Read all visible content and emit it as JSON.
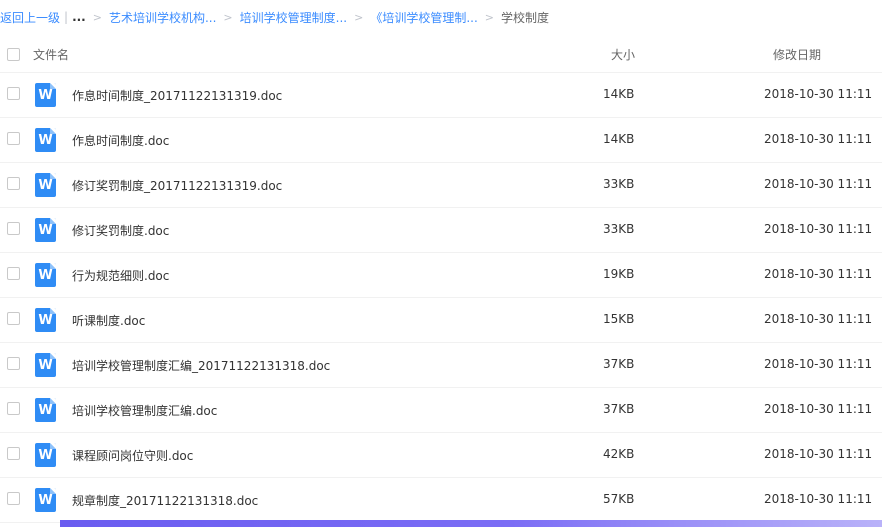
{
  "breadcrumb": {
    "back_label": "返回上一级",
    "ellipsis": "...",
    "items": [
      "艺术培训学校机构...",
      "培训学校管理制度...",
      "《培训学校管理制..."
    ],
    "current": "学校制度",
    "separator": ">"
  },
  "table": {
    "columns": {
      "name": "文件名",
      "size": "大小",
      "modified": "修改日期"
    },
    "rows": [
      {
        "name": "作息时间制度_20171122131319.doc",
        "size": "14KB",
        "modified": "2018-10-30 11:11",
        "icon": "word-doc-icon"
      },
      {
        "name": "作息时间制度.doc",
        "size": "14KB",
        "modified": "2018-10-30 11:11",
        "icon": "word-doc-icon"
      },
      {
        "name": "修订奖罚制度_20171122131319.doc",
        "size": "33KB",
        "modified": "2018-10-30 11:11",
        "icon": "word-doc-icon"
      },
      {
        "name": "修订奖罚制度.doc",
        "size": "33KB",
        "modified": "2018-10-30 11:11",
        "icon": "word-doc-icon"
      },
      {
        "name": "行为规范细则.doc",
        "size": "19KB",
        "modified": "2018-10-30 11:11",
        "icon": "word-doc-icon"
      },
      {
        "name": "听课制度.doc",
        "size": "15KB",
        "modified": "2018-10-30 11:11",
        "icon": "word-doc-icon"
      },
      {
        "name": "培训学校管理制度汇编_20171122131318.doc",
        "size": "37KB",
        "modified": "2018-10-30 11:11",
        "icon": "word-doc-icon"
      },
      {
        "name": "培训学校管理制度汇编.doc",
        "size": "37KB",
        "modified": "2018-10-30 11:11",
        "icon": "word-doc-icon"
      },
      {
        "name": "课程顾问岗位守则.doc",
        "size": "42KB",
        "modified": "2018-10-30 11:11",
        "icon": "word-doc-icon"
      },
      {
        "name": "规章制度_20171122131318.doc",
        "size": "57KB",
        "modified": "2018-10-30 11:11",
        "icon": "word-doc-icon"
      }
    ]
  },
  "icon_letter": "W",
  "colors": {
    "accent": "#3b8cff",
    "word_icon": "#2f8cf5",
    "footer_bar": "#6a5cf0"
  }
}
